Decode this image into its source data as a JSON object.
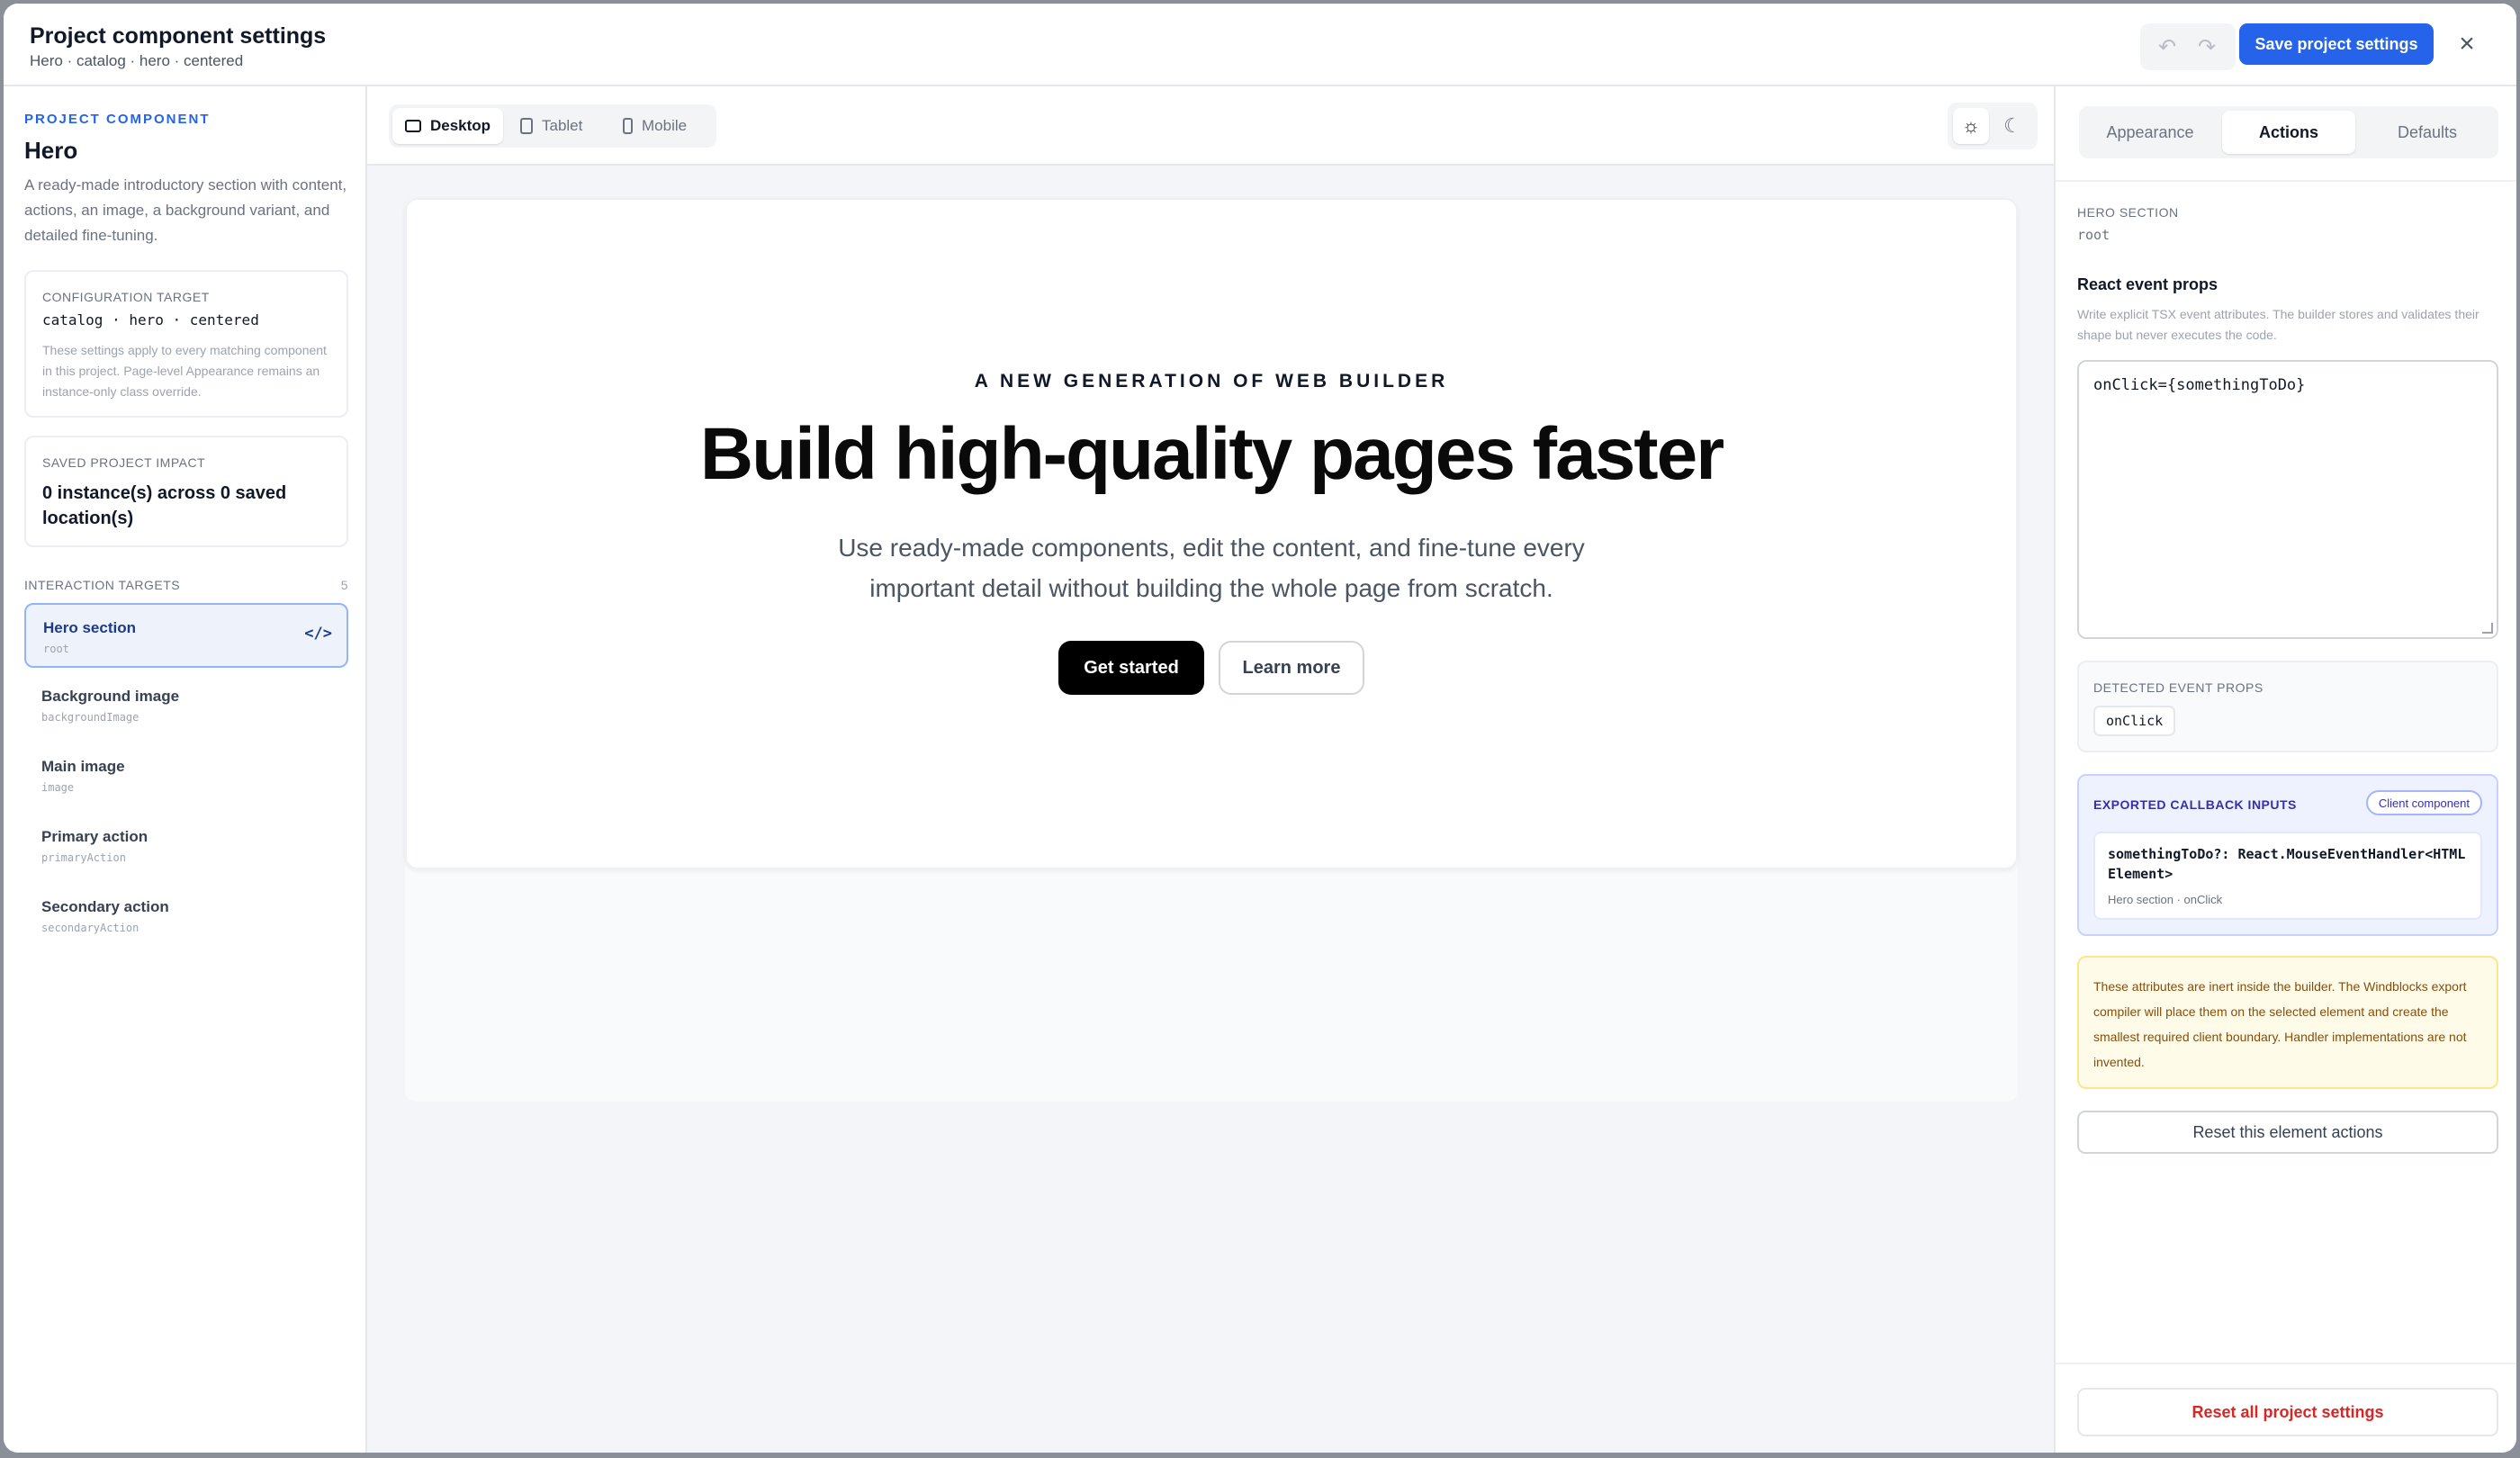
{
  "header": {
    "title": "Project component settings",
    "subtitle": "Hero · catalog · hero · centered",
    "save_label": "Save project settings",
    "close_icon": "×",
    "undo_icon": "↶",
    "redo_icon": "↷"
  },
  "sidebar": {
    "eyebrow": "PROJECT COMPONENT",
    "component_name": "Hero",
    "description": "A ready-made introductory section with content, actions, an image, a background variant, and detailed fine-tuning.",
    "config_target": {
      "label": "CONFIGURATION TARGET",
      "value": "catalog · hero · centered",
      "note": "These settings apply to every matching component in this project. Page-level Appearance remains an instance-only class override."
    },
    "impact": {
      "label": "SAVED PROJECT IMPACT",
      "value": "0 instance(s) across 0 saved location(s)"
    },
    "targets_label": "INTERACTION TARGETS",
    "targets_count": "5",
    "code_icon": "</>",
    "targets": [
      {
        "name": "Hero section",
        "key": "root"
      },
      {
        "name": "Background image",
        "key": "backgroundImage"
      },
      {
        "name": "Main image",
        "key": "image"
      },
      {
        "name": "Primary action",
        "key": "primaryAction"
      },
      {
        "name": "Secondary action",
        "key": "secondaryAction"
      }
    ]
  },
  "canvas": {
    "devices": [
      {
        "label": "Desktop"
      },
      {
        "label": "Tablet"
      },
      {
        "label": "Mobile"
      }
    ],
    "theme_light_icon": "☼",
    "theme_dark_icon": "☾",
    "preview": {
      "eyebrow": "A NEW GENERATION OF WEB BUILDER",
      "title": "Build high-quality pages faster",
      "subtitle": "Use ready-made components, edit the content, and fine-tune every important detail without building the whole page from scratch.",
      "primary": "Get started",
      "secondary": "Learn more"
    }
  },
  "panel": {
    "tabs": [
      {
        "label": "Appearance"
      },
      {
        "label": "Actions"
      },
      {
        "label": "Defaults"
      }
    ],
    "section_label": "HERO SECTION",
    "section_key": "root",
    "heading": "React event props",
    "help": "Write explicit TSX event attributes. The builder stores and validates their shape but never executes the code.",
    "editor_value": "onClick={somethingToDo}",
    "detected_label": "DETECTED EVENT PROPS",
    "detected_chip": "onClick",
    "callback_label": "EXPORTED CALLBACK INPUTS",
    "callback_badge": "Client component",
    "callback_signature": "somethingToDo?: React.MouseEventHandler<HTMLElement>",
    "callback_meta": "Hero section · onClick",
    "warning": "These attributes are inert inside the builder. The Windblocks export compiler will place them on the selected element and create the smallest required client boundary. Handler implementations are not invented.",
    "reset_element": "Reset this element actions",
    "reset_all": "Reset all project settings"
  },
  "colors": {
    "accent": "#2563eb",
    "danger": "#dc2626",
    "warning_bg": "#fefce8",
    "callback_bg": "#eef2ff"
  }
}
